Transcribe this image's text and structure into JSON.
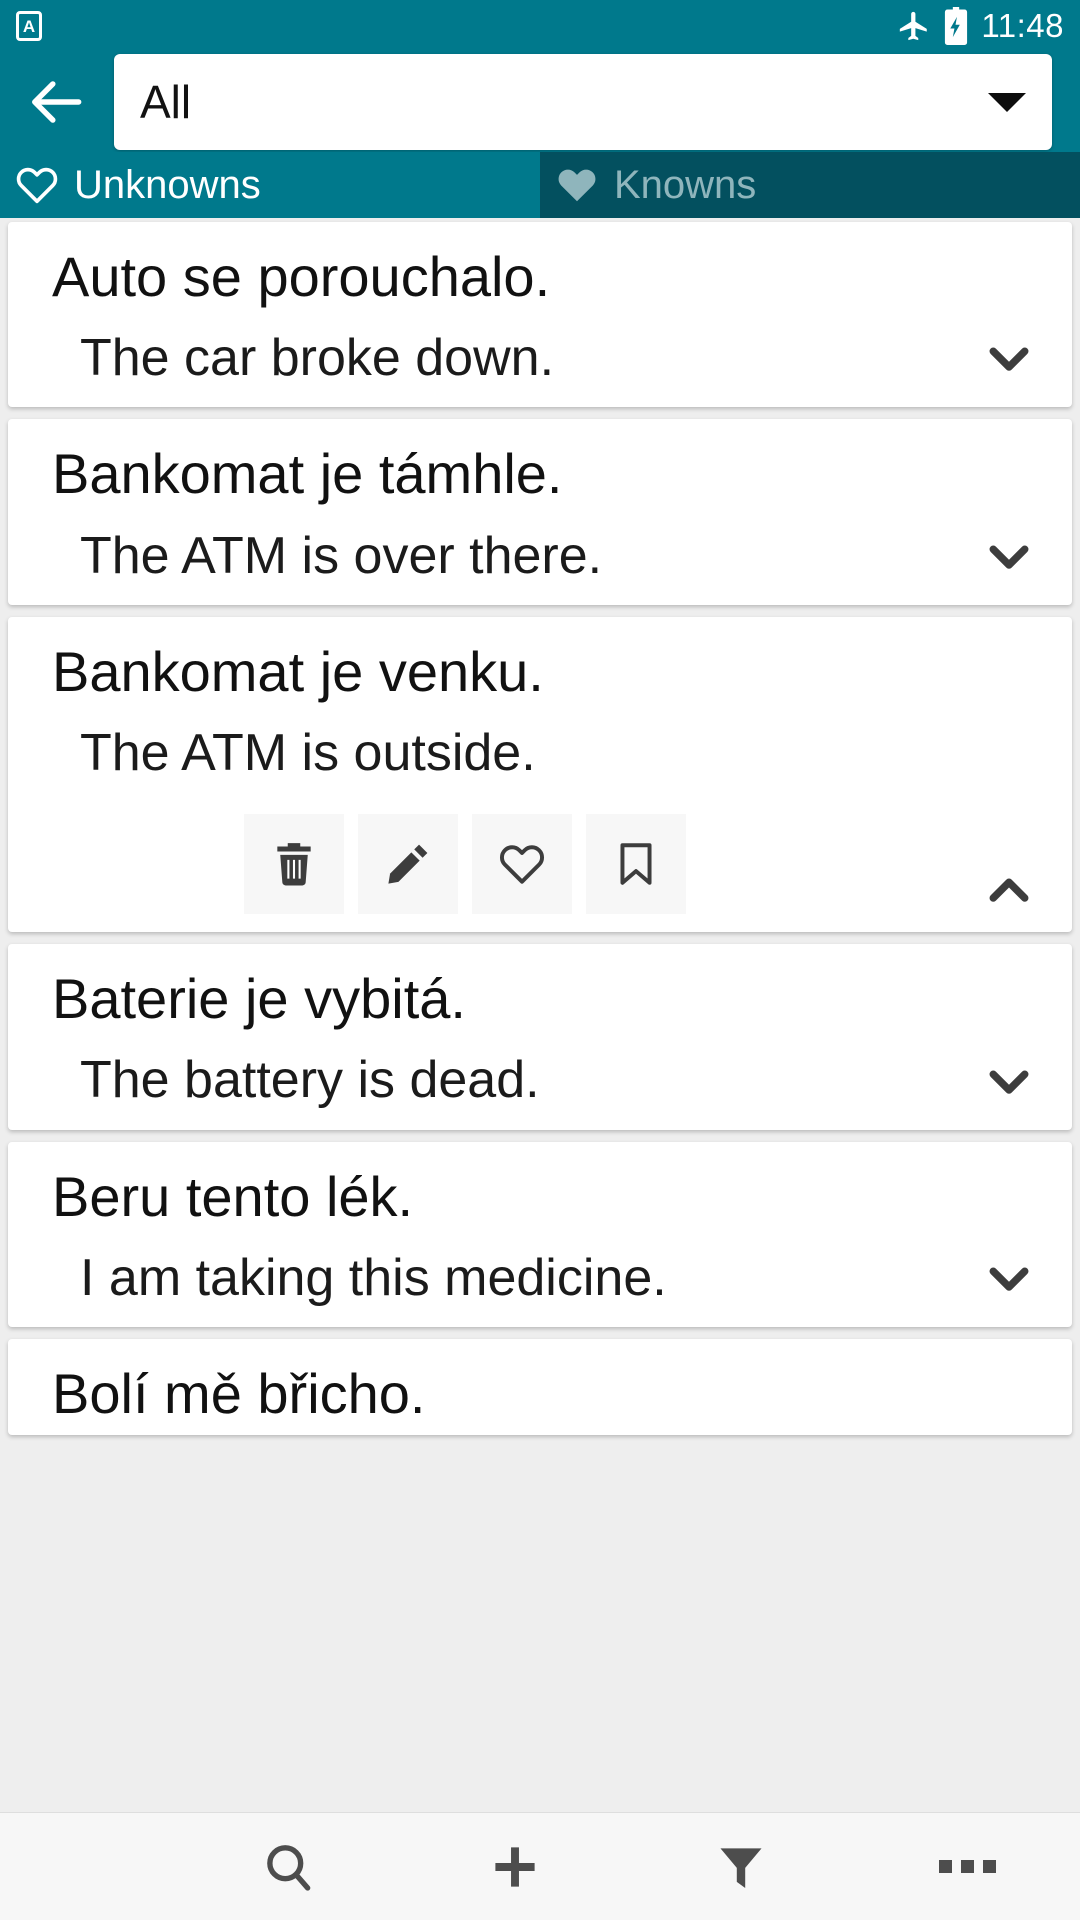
{
  "colors": {
    "primary": "#00798c",
    "primary_dark": "#03505f",
    "tab_inactive_text": "#8fb5bc",
    "card_bg": "#ffffff",
    "list_bg": "#eeeeee",
    "icon_dark": "#3d3d3d",
    "bottom_bar_bg": "#f7f7f7"
  },
  "status_bar": {
    "app_badge_letter": "A",
    "app_badge_icon": "app-notification-icon",
    "airplane_icon": "airplane-mode-icon",
    "battery_icon": "battery-charging-icon",
    "time": "11:48"
  },
  "toolbar": {
    "back_icon": "back-arrow-icon",
    "spinner": {
      "value": "All",
      "caret_icon": "dropdown-caret-icon"
    }
  },
  "tabs": [
    {
      "label": "Unknowns",
      "icon": "heart-outline-icon",
      "active": true
    },
    {
      "label": "Knowns",
      "icon": "heart-filled-icon",
      "active": false
    }
  ],
  "cards": [
    {
      "term": "Auto se porouchalo.",
      "translation": "The car broke down.",
      "expanded": false,
      "chevron_icon": "chevron-down-icon"
    },
    {
      "term": "Bankomat je támhle.",
      "translation": "The ATM is over there.",
      "expanded": false,
      "chevron_icon": "chevron-down-icon"
    },
    {
      "term": "Bankomat je venku.",
      "translation": "The ATM is outside.",
      "expanded": true,
      "chevron_icon": "chevron-up-icon"
    },
    {
      "term": "Baterie je vybitá.",
      "translation": "The battery is dead.",
      "expanded": false,
      "chevron_icon": "chevron-down-icon"
    },
    {
      "term": "Beru tento lék.",
      "translation": "I am taking this medicine.",
      "expanded": false,
      "chevron_icon": "chevron-down-icon"
    },
    {
      "term": "Bolí mě břicho.",
      "translation": "",
      "expanded": false,
      "chevron_icon": "chevron-down-icon"
    }
  ],
  "card_actions": [
    {
      "name": "delete",
      "icon": "trash-icon"
    },
    {
      "name": "edit",
      "icon": "pencil-icon"
    },
    {
      "name": "favorite",
      "icon": "heart-outline-icon"
    },
    {
      "name": "bookmark",
      "icon": "bookmark-outline-icon"
    }
  ],
  "bottom_bar": [
    {
      "name": "search",
      "icon": "search-icon"
    },
    {
      "name": "add",
      "icon": "plus-icon"
    },
    {
      "name": "filter",
      "icon": "funnel-icon"
    },
    {
      "name": "more",
      "icon": "overflow-dots-icon"
    }
  ]
}
